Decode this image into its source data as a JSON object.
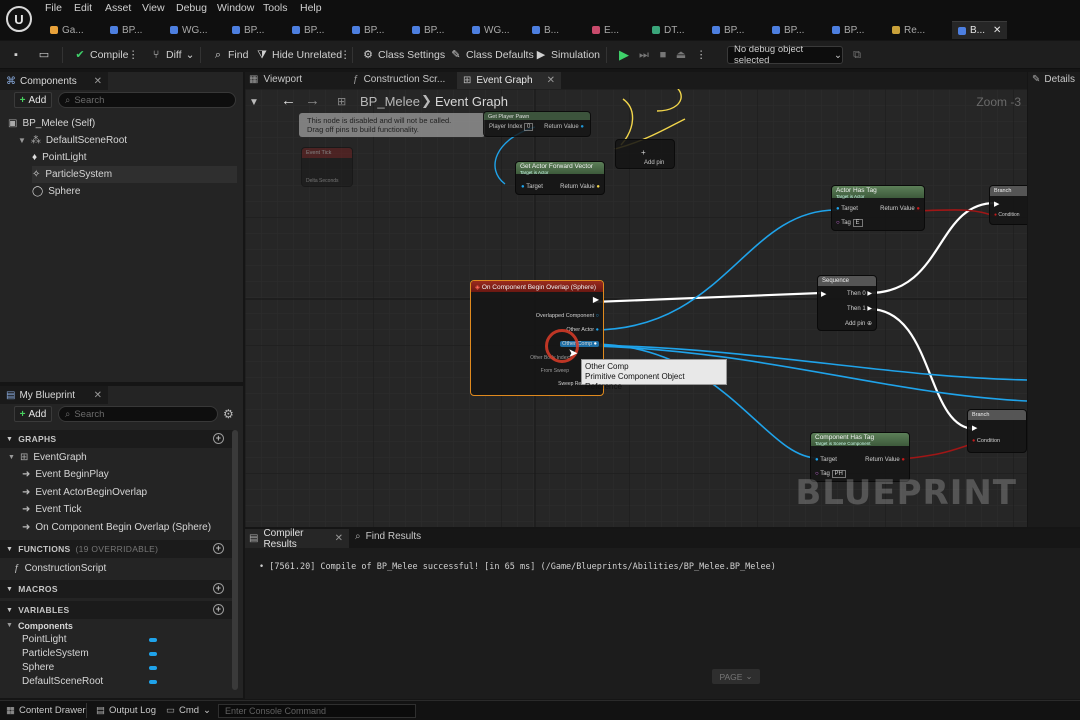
{
  "menu": [
    "File",
    "Edit",
    "Asset",
    "View",
    "Debug",
    "Window",
    "Tools",
    "Help"
  ],
  "doc_tabs": [
    {
      "label": "Ga...",
      "color": "#e8a23a"
    },
    {
      "label": "BP...",
      "color": "#4d7fe0"
    },
    {
      "label": "WG...",
      "color": "#4d7fe0"
    },
    {
      "label": "BP...",
      "color": "#4d7fe0"
    },
    {
      "label": "BP...",
      "color": "#4d7fe0"
    },
    {
      "label": "BP...",
      "color": "#4d7fe0"
    },
    {
      "label": "BP...",
      "color": "#4d7fe0"
    },
    {
      "label": "WG...",
      "color": "#4d7fe0"
    },
    {
      "label": "B...",
      "color": "#4d7fe0"
    },
    {
      "label": "E...",
      "color": "#c84a6b"
    },
    {
      "label": "DT...",
      "color": "#3aa57a"
    },
    {
      "label": "BP...",
      "color": "#4d7fe0"
    },
    {
      "label": "BP...",
      "color": "#4d7fe0"
    },
    {
      "label": "BP...",
      "color": "#4d7fe0"
    },
    {
      "label": "Re...",
      "color": "#c9a13a"
    },
    {
      "label": "B...",
      "color": "#4d7fe0"
    }
  ],
  "toolbar": {
    "compile": "Compile",
    "diff": "Diff",
    "find": "Find",
    "hide_unrelated": "Hide Unrelated",
    "class_settings": "Class Settings",
    "class_defaults": "Class Defaults",
    "simulation": "Simulation",
    "debug_object": "No debug object selected"
  },
  "components_panel": {
    "title": "Components",
    "add": "Add",
    "search_placeholder": "Search",
    "tree": [
      "BP_Melee (Self)",
      "DefaultSceneRoot",
      "PointLight",
      "ParticleSystem",
      "Sphere"
    ]
  },
  "my_blueprint": {
    "title": "My Blueprint",
    "add": "Add",
    "search_placeholder": "Search",
    "graphs_header": "GRAPHS",
    "event_graph": "EventGraph",
    "events": [
      "Event BeginPlay",
      "Event ActorBeginOverlap",
      "Event Tick",
      "On Component Begin Overlap (Sphere)"
    ],
    "functions_header": "FUNCTIONS",
    "functions_overridable": "(19 OVERRIDABLE)",
    "functions": [
      "ConstructionScript"
    ],
    "macros_header": "MACROS",
    "variables_header": "VARIABLES",
    "var_category": "Components",
    "variables": [
      "PointLight",
      "ParticleSystem",
      "Sphere",
      "DefaultSceneRoot"
    ]
  },
  "editor_tabs": [
    "Viewport",
    "Construction Scr...",
    "Event Graph"
  ],
  "breadcrumb": {
    "blueprint": "BP_Melee",
    "graph": "Event Graph",
    "zoom": "Zoom -3"
  },
  "graph": {
    "disabled_note_1": "This node is disabled and will not be called.",
    "disabled_note_2": "Drag off pins to build functionality.",
    "get_player_pawn": "Get Player Pawn",
    "player_index": "Player Index",
    "player_index_val": "0",
    "return_value": "Return Value",
    "event_tick": "Event Tick",
    "delta_seconds": "Delta Seconds",
    "get_forward": "Get Actor Forward Vector",
    "target_is_actor": "Target is Actor",
    "target": "Target",
    "add_pin": "Add pin",
    "actor_has_tag": "Actor Has Tag",
    "tag": "Tag",
    "tag_val_1": "E",
    "branch": "Branch",
    "condition": "Condition",
    "sequence": "Sequence",
    "then_0": "Then 0",
    "then_1": "Then 1",
    "overlap_node": "On Component Begin Overlap (Sphere)",
    "overlapped_component": "Overlapped Component",
    "other_actor": "Other Actor",
    "other_comp": "Other Comp",
    "other_body_index": "Other Body Index",
    "from_sweep": "From Sweep",
    "sweep_result": "Sweep Result",
    "component_has_tag": "Component Has Tag",
    "target_is_scene": "Target is Scene Component",
    "tag_val_2": "PH",
    "watermark": "BLUEPRINT"
  },
  "tooltip": {
    "title": "Other Comp",
    "subtitle": "Primitive Component Object Reference"
  },
  "bottom_panel": {
    "tabs": [
      "Compiler Results",
      "Find Results"
    ],
    "log_line": "[7561.20] Compile of BP_Melee successful! [in 65 ms] (/Game/Blueprints/Abilities/BP_Melee.BP_Melee)",
    "page_button": "PAGE"
  },
  "details_tab": "Details",
  "statusbar": {
    "content_drawer": "Content Drawer",
    "output_log": "Output Log",
    "cmd": "Cmd",
    "console_placeholder": "Enter Console Command"
  },
  "colors": {
    "exec_white": "#ffffff",
    "object_pin_blue": "#1fa3ea",
    "bool_red": "#b11b1b",
    "event_header": "#8c1b14",
    "pure_green": "#4e6b4b",
    "selected_outline": "#e08a1e"
  }
}
